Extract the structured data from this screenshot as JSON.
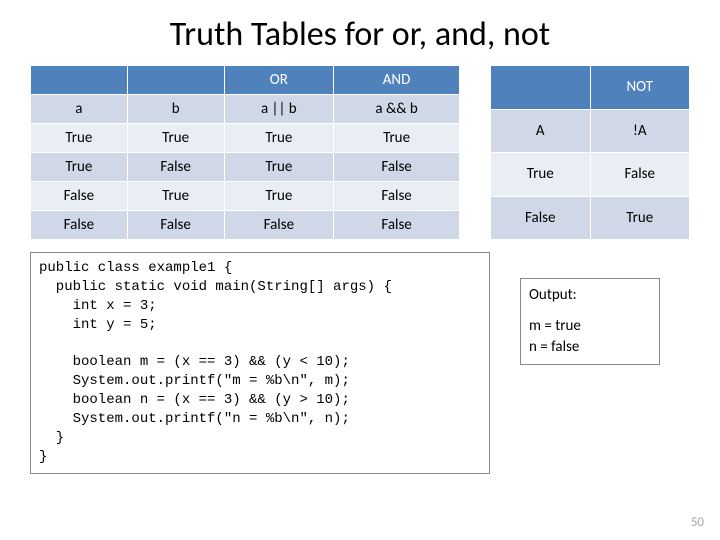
{
  "title": "Truth Tables for or, and, not",
  "left_table": {
    "top": {
      "or": "OR",
      "and": "AND"
    },
    "sub": {
      "a": "a",
      "b": "b",
      "or": "a || b",
      "and": "a && b"
    },
    "rows": [
      {
        "a": "True",
        "b": "True",
        "or": "True",
        "and": "True"
      },
      {
        "a": "True",
        "b": "False",
        "or": "True",
        "and": "False"
      },
      {
        "a": "False",
        "b": "True",
        "or": "True",
        "and": "False"
      },
      {
        "a": "False",
        "b": "False",
        "or": "False",
        "and": "False"
      }
    ]
  },
  "right_table": {
    "top": {
      "not": "NOT"
    },
    "sub": {
      "a": "A",
      "not": "!A"
    },
    "rows": [
      {
        "a": "True",
        "not": "False"
      },
      {
        "a": "False",
        "not": "True"
      }
    ]
  },
  "code": "public class example1 {\n  public static void main(String[] args) {\n    int x = 3;\n    int y = 5;\n\n    boolean m = (x == 3) && (y < 10);\n    System.out.printf(\"m = %b\\n\", m);\n    boolean n = (x == 3) && (y > 10);\n    System.out.printf(\"n = %b\\n\", n);\n  }\n}",
  "output": {
    "label": "Output:",
    "line1": "m = true",
    "line2": "n = false"
  },
  "page_number": "50"
}
